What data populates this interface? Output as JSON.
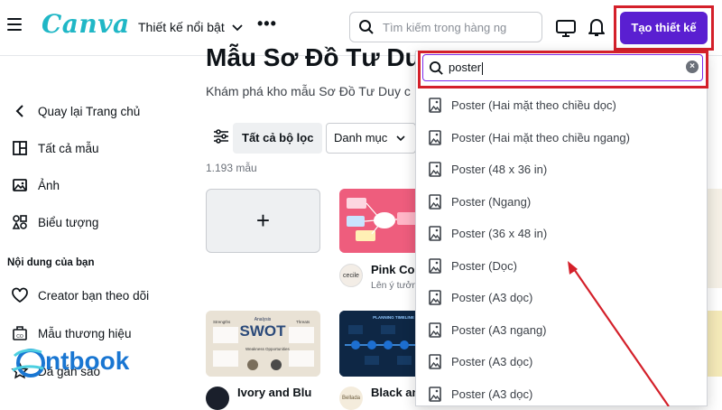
{
  "header": {
    "logo": "Canva",
    "featured_menu": "Thiết kế nổi bật",
    "more": "•••",
    "search_placeholder": "Tìm kiếm trong hàng ng",
    "create_button": "Tạo thiết kế"
  },
  "page": {
    "title": "Mẫu Sơ Đồ Tư Du",
    "subtitle": "Khám phá kho mẫu Sơ Đồ Tư Duy c",
    "filter_all": "Tất cả bộ lọc",
    "category": "Danh mục",
    "count": "1.193 mẫu"
  },
  "sidebar": {
    "back": "Quay lại Trang chủ",
    "items": [
      {
        "label": "Tất cả mẫu",
        "icon": "layout-icon"
      },
      {
        "label": "Ảnh",
        "icon": "image-icon"
      },
      {
        "label": "Biểu tượng",
        "icon": "shapes-icon"
      }
    ],
    "section": "Nội dung của bạn",
    "content_items": [
      {
        "label": "Creator bạn theo dõi",
        "icon": "heart-icon"
      },
      {
        "label": "Mẫu thương hiệu",
        "icon": "brand-icon"
      },
      {
        "label": "Đã gắn sao",
        "icon": "star-icon"
      }
    ]
  },
  "cards": [
    {
      "title": "Pink Col",
      "subtitle": "Lên ý tưởn",
      "avatar": "cecile"
    },
    {
      "title": "Ivory and Blu",
      "subtitle": "",
      "avatar": ""
    },
    {
      "title": "Black an",
      "subtitle": "",
      "avatar": "Bellada"
    }
  ],
  "thumb_text": {
    "swot": "SWOT",
    "analysis": "Analysis",
    "strengths": "Strengths",
    "threats": "Threats",
    "weakness": "Weakness",
    "opportunities": "Opportunities",
    "timeline": "PLANNING TIMELINE"
  },
  "search": {
    "value": "poster",
    "suggestions": [
      "Poster (Hai mặt theo chiều dọc)",
      "Poster (Hai mặt theo chiều ngang)",
      "Poster (48 x 36 in)",
      "Poster (Ngang)",
      "Poster (36 x 48 in)",
      "Poster (Dọc)",
      "Poster (A3 dọc)",
      "Poster (A3 ngang)",
      "Poster (A3 dọc)",
      "Poster (A3 dọc)"
    ]
  },
  "watermark": "ntbook",
  "colors": {
    "brand": "#20b7c6",
    "create_button": "#5a1fd1",
    "highlight": "#d4202a"
  }
}
